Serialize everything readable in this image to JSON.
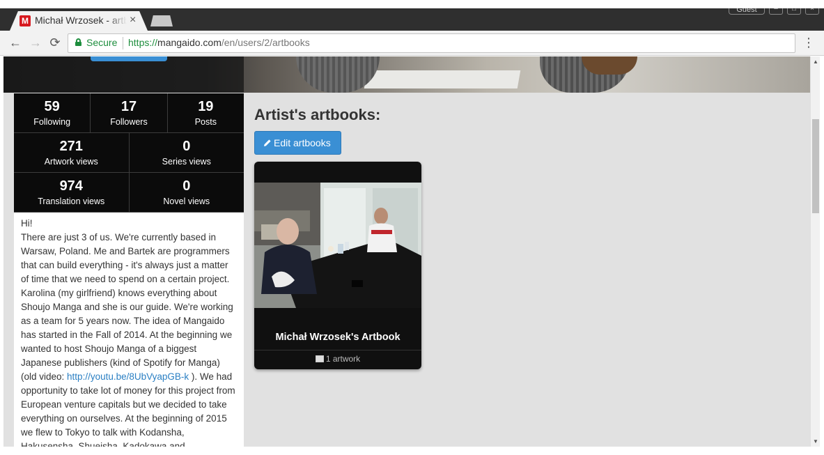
{
  "browser": {
    "tab_title": "Michał Wrzosek - artbooks",
    "tab_close": "×",
    "favicon_letter": "M",
    "guest_label": "Guest",
    "secure_label": "Secure",
    "url_scheme": "https://",
    "url_host": "mangaido.com",
    "url_path": "/en/users/2/artbooks",
    "back_icon": "←",
    "forward_icon": "→",
    "reload_icon": "⟳",
    "menu_icon": "⋮",
    "window_minimize": "–",
    "window_maximize": "□",
    "window_close": "×"
  },
  "stats": {
    "following": {
      "value": "59",
      "label": "Following"
    },
    "followers": {
      "value": "17",
      "label": "Followers"
    },
    "posts": {
      "value": "19",
      "label": "Posts"
    },
    "artwork_views": {
      "value": "271",
      "label": "Artwork views"
    },
    "series_views": {
      "value": "0",
      "label": "Series views"
    },
    "translation_views": {
      "value": "974",
      "label": "Translation views"
    },
    "novel_views": {
      "value": "0",
      "label": "Novel views"
    }
  },
  "bio": {
    "greeting": "Hi!",
    "text_before_link": "There are just 3 of us. We're currently based in Warsaw, Poland. Me and Bartek are programmers that can build everything - it's always just a matter of time that we need to spend on a certain project. Karolina (my girlfriend) knows everything about Shoujo Manga and she is our guide. We're working as a team for 5 years now. The idea of Mangaido has started in the Fall of 2014. At the beginning we wanted to host Shoujo Manga of a biggest Japanese publishers (kind of Spotify for Manga) (old video: ",
    "link_text": "http://youtu.be/8UbVyapGB-k",
    "text_after_link": " ). We had opportunity to take lot of money for this project from European venture capitals but we decided to take everything on ourselves. At the beginning of 2015 we flew to Tokyo to talk with Kodansha, Hakusensha, Shueisha, Kadokawa and"
  },
  "main": {
    "title": "Artist's artbooks:",
    "edit_button": "Edit artbooks",
    "artbooks": [
      {
        "title": "Michał Wrzosek's Artbook",
        "meta": "1 artwork"
      }
    ]
  },
  "colors": {
    "accent": "#3a8fd4",
    "secure_green": "#1e8e3e",
    "stats_bg": "#0b0b0b",
    "page_bg": "#e1e1e1"
  }
}
